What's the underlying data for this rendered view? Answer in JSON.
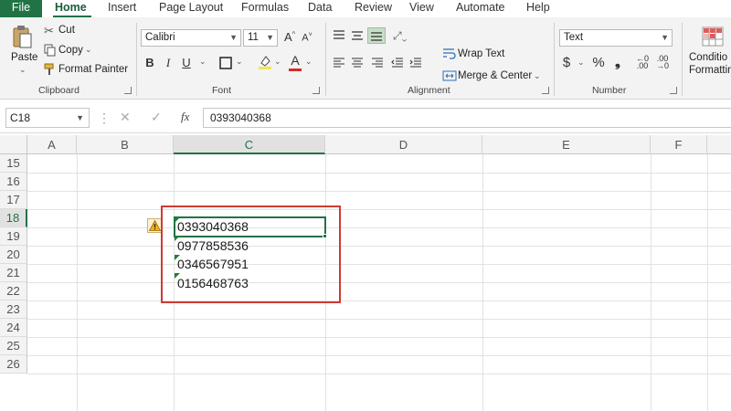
{
  "menu": {
    "tabs": [
      "File",
      "Home",
      "Insert",
      "Page Layout",
      "Formulas",
      "Data",
      "Review",
      "View",
      "Automate",
      "Help"
    ]
  },
  "ribbon": {
    "clipboard": {
      "paste": "Paste",
      "cut": "Cut",
      "copy": "Copy",
      "format_painter": "Format Painter",
      "label": "Clipboard"
    },
    "font": {
      "name": "Calibri",
      "size": "11",
      "label": "Font",
      "bold": "B",
      "italic": "I",
      "underline": "U"
    },
    "alignment": {
      "wrap_text": "Wrap Text",
      "merge_center": "Merge & Center",
      "label": "Alignment"
    },
    "number": {
      "format": "Text",
      "currency": "$",
      "percent": "%",
      "comma": "❟",
      "label": "Number"
    },
    "styles": {
      "conditional": "Conditio",
      "formatting": "Formattin"
    }
  },
  "formula_bar": {
    "name_box": "C18",
    "fx": "fx",
    "value": "0393040368"
  },
  "grid": {
    "columns": [
      "A",
      "B",
      "C",
      "D",
      "E",
      "F"
    ],
    "rows": [
      "15",
      "16",
      "17",
      "18",
      "19",
      "20",
      "21",
      "22",
      "23",
      "24",
      "25",
      "26"
    ],
    "cells": [
      "0393040368",
      "0977858536",
      "0346567951",
      "0156468763"
    ],
    "active_cell": "C18"
  },
  "colors": {
    "brand": "#217346",
    "highlight_box": "#d03a32",
    "selection": "#217346"
  }
}
